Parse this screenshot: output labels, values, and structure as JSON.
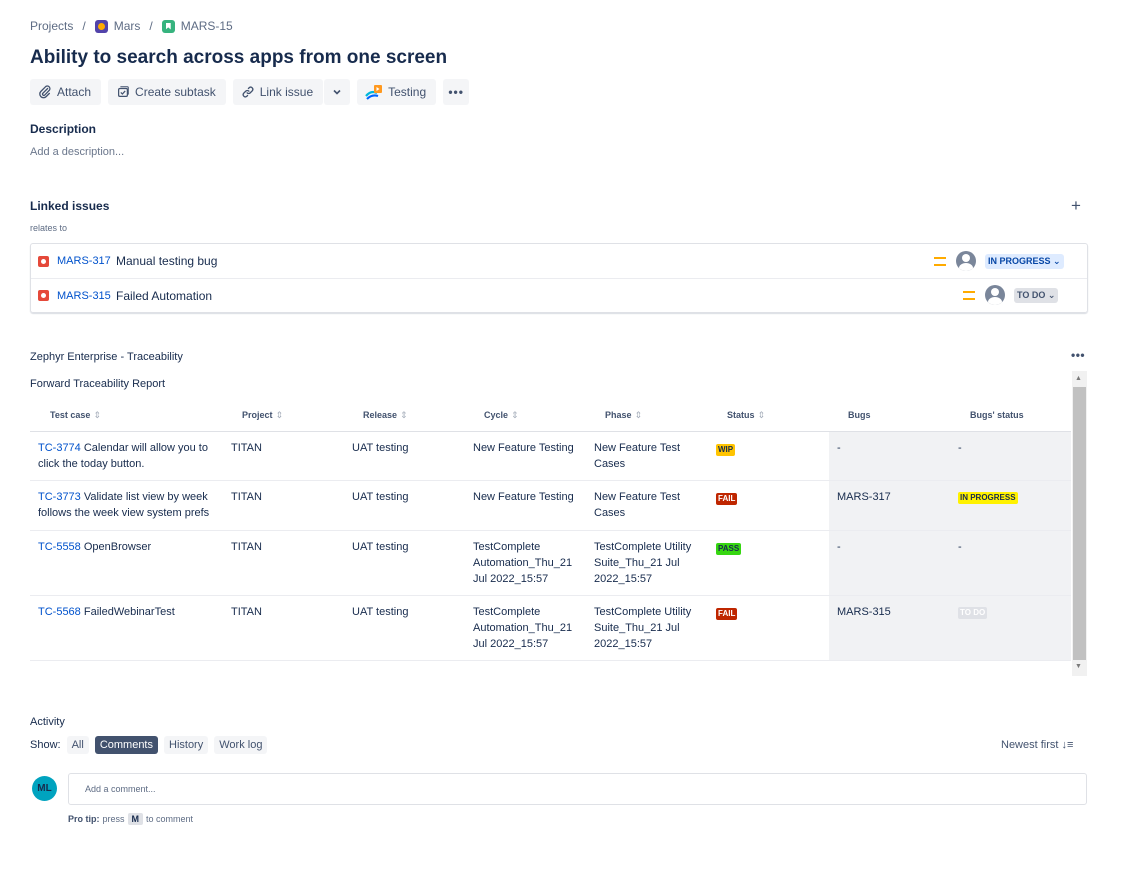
{
  "breadcrumb": {
    "projects": "Projects",
    "project": "Mars",
    "issue_key": "MARS-15",
    "separator": "/"
  },
  "issue": {
    "title": "Ability to search across apps from one screen"
  },
  "toolbar": {
    "attach": "Attach",
    "create_subtask": "Create subtask",
    "link_issue": "Link issue",
    "testing": "Testing",
    "more": "•••"
  },
  "description": {
    "label": "Description",
    "placeholder": "Add a description..."
  },
  "linked_issues": {
    "label": "Linked issues",
    "add": "+",
    "relation": "relates to",
    "items": [
      {
        "key": "MARS-317",
        "summary": "Manual testing bug",
        "status": "IN PROGRESS ⌄",
        "priority": "medium"
      },
      {
        "key": "MARS-315",
        "summary": "Failed Automation",
        "status": "TO DO ⌄",
        "priority": "medium"
      }
    ]
  },
  "zephyr": {
    "label": "Zephyr Enterprise - Traceability",
    "more": "•••",
    "report_title": "Forward Traceability Report",
    "sort_glyph": "⇕",
    "columns": [
      "Test case",
      "Project",
      "Release",
      "Cycle",
      "Phase",
      "Status",
      "Bugs",
      "Bugs' status"
    ],
    "rows": [
      {
        "tc_key": "TC-3774",
        "tc_name": " Calendar will allow you to click the today button.",
        "project": "TITAN",
        "release": "UAT testing",
        "cycle": "New Feature Testing",
        "phase": "New Feature Test Cases",
        "status": "WIP",
        "bugs": "-",
        "bugs_status": "-"
      },
      {
        "tc_key": "TC-3773",
        "tc_name": " Validate list view by week follows the week view system prefs",
        "project": "TITAN",
        "release": "UAT testing",
        "cycle": "New Feature Testing",
        "phase": "New Feature Test Cases",
        "status": "FAIL",
        "bugs": "MARS-317",
        "bugs_status": "IN PROGRESS"
      },
      {
        "tc_key": "TC-5558",
        "tc_name": " OpenBrowser",
        "project": "TITAN",
        "release": "UAT testing",
        "cycle": "TestComplete Automation_Thu_21 Jul 2022_15:57",
        "phase": "TestComplete Utility Suite_Thu_21 Jul 2022_15:57",
        "status": "PASS",
        "bugs": "-",
        "bugs_status": "-"
      },
      {
        "tc_key": "TC-5568",
        "tc_name": " FailedWebinarTest",
        "project": "TITAN",
        "release": "UAT testing",
        "cycle": "TestComplete Automation_Thu_21 Jul 2022_15:57",
        "phase": "TestComplete Utility Suite_Thu_21 Jul 2022_15:57",
        "status": "FAIL",
        "bugs": "MARS-315",
        "bugs_status": "TO DO"
      }
    ]
  },
  "activity": {
    "label": "Activity",
    "show": "Show:",
    "filters": [
      "All",
      "Comments",
      "History",
      "Work log"
    ],
    "active_filter": "Comments",
    "sort": "Newest first ↓≡",
    "avatar_initials": "ML",
    "comment_placeholder": "Add a comment...",
    "protip_label": "Pro tip:",
    "protip_press": "press",
    "protip_key": "M",
    "protip_suffix": "to comment"
  },
  "colors": {
    "link": "#0052cc",
    "text": "#172b4d",
    "wip": "#ffc400",
    "fail": "#bf2600",
    "pass": "#36d611",
    "bug_in_progress": "#fff200"
  }
}
